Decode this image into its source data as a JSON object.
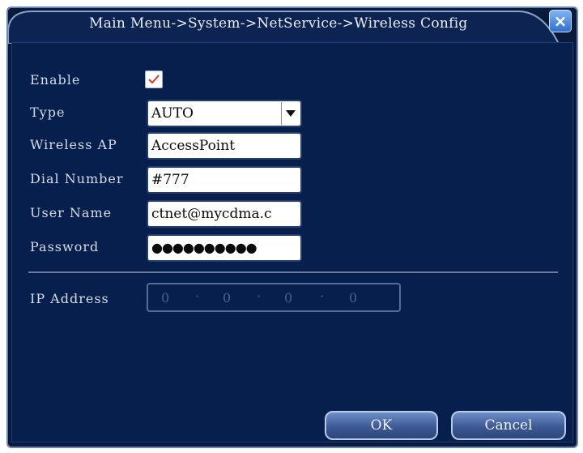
{
  "window": {
    "title": "Main Menu->System->NetService->Wireless Config",
    "close_glyph": "×"
  },
  "form": {
    "enable": {
      "label": "Enable",
      "checked": true
    },
    "type": {
      "label": "Type",
      "value": "AUTO"
    },
    "wireless_ap": {
      "label": "Wireless AP",
      "value": "AccessPoint"
    },
    "dial_number": {
      "label": "Dial Number",
      "value": "#777"
    },
    "user_name": {
      "label": "User Name",
      "value": "ctnet@mycdma.c"
    },
    "password": {
      "label": "Password",
      "value": "●●●●●●●●●●"
    },
    "ip_address": {
      "label": "IP Address",
      "octets": [
        "0",
        "0",
        "0",
        "0"
      ]
    }
  },
  "buttons": {
    "ok": "OK",
    "cancel": "Cancel"
  },
  "colors": {
    "background": "#061f4d",
    "accent": "#6a86b6",
    "check": "#d83a2a"
  },
  "icons": {
    "close": "close-icon",
    "dropdown": "chevron-down-icon",
    "check": "checkmark-icon"
  }
}
